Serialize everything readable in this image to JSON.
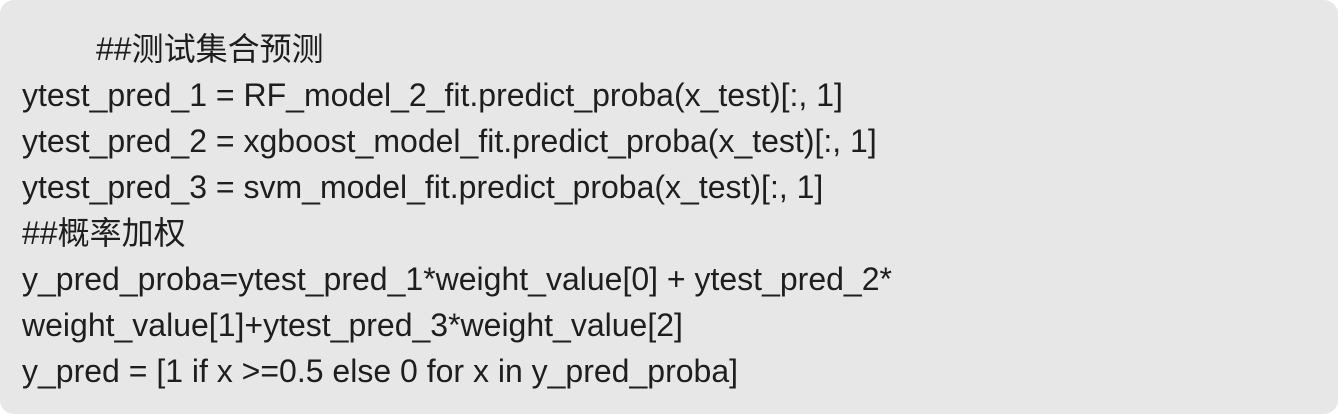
{
  "code_block": {
    "lines": [
      "##测试集合预测",
      "ytest_pred_1 = RF_model_2_fit.predict_proba(x_test)[:, 1]",
      "ytest_pred_2 = xgboost_model_fit.predict_proba(x_test)[:, 1]",
      "ytest_pred_3 = svm_model_fit.predict_proba(x_test)[:, 1]",
      "##概率加权",
      "y_pred_proba=ytest_pred_1*weight_value[0] + ytest_pred_2*",
      "weight_value[1]+ytest_pred_3*weight_value[2]",
      "y_pred = [1 if x >=0.5 else 0 for x in y_pred_proba]"
    ]
  }
}
